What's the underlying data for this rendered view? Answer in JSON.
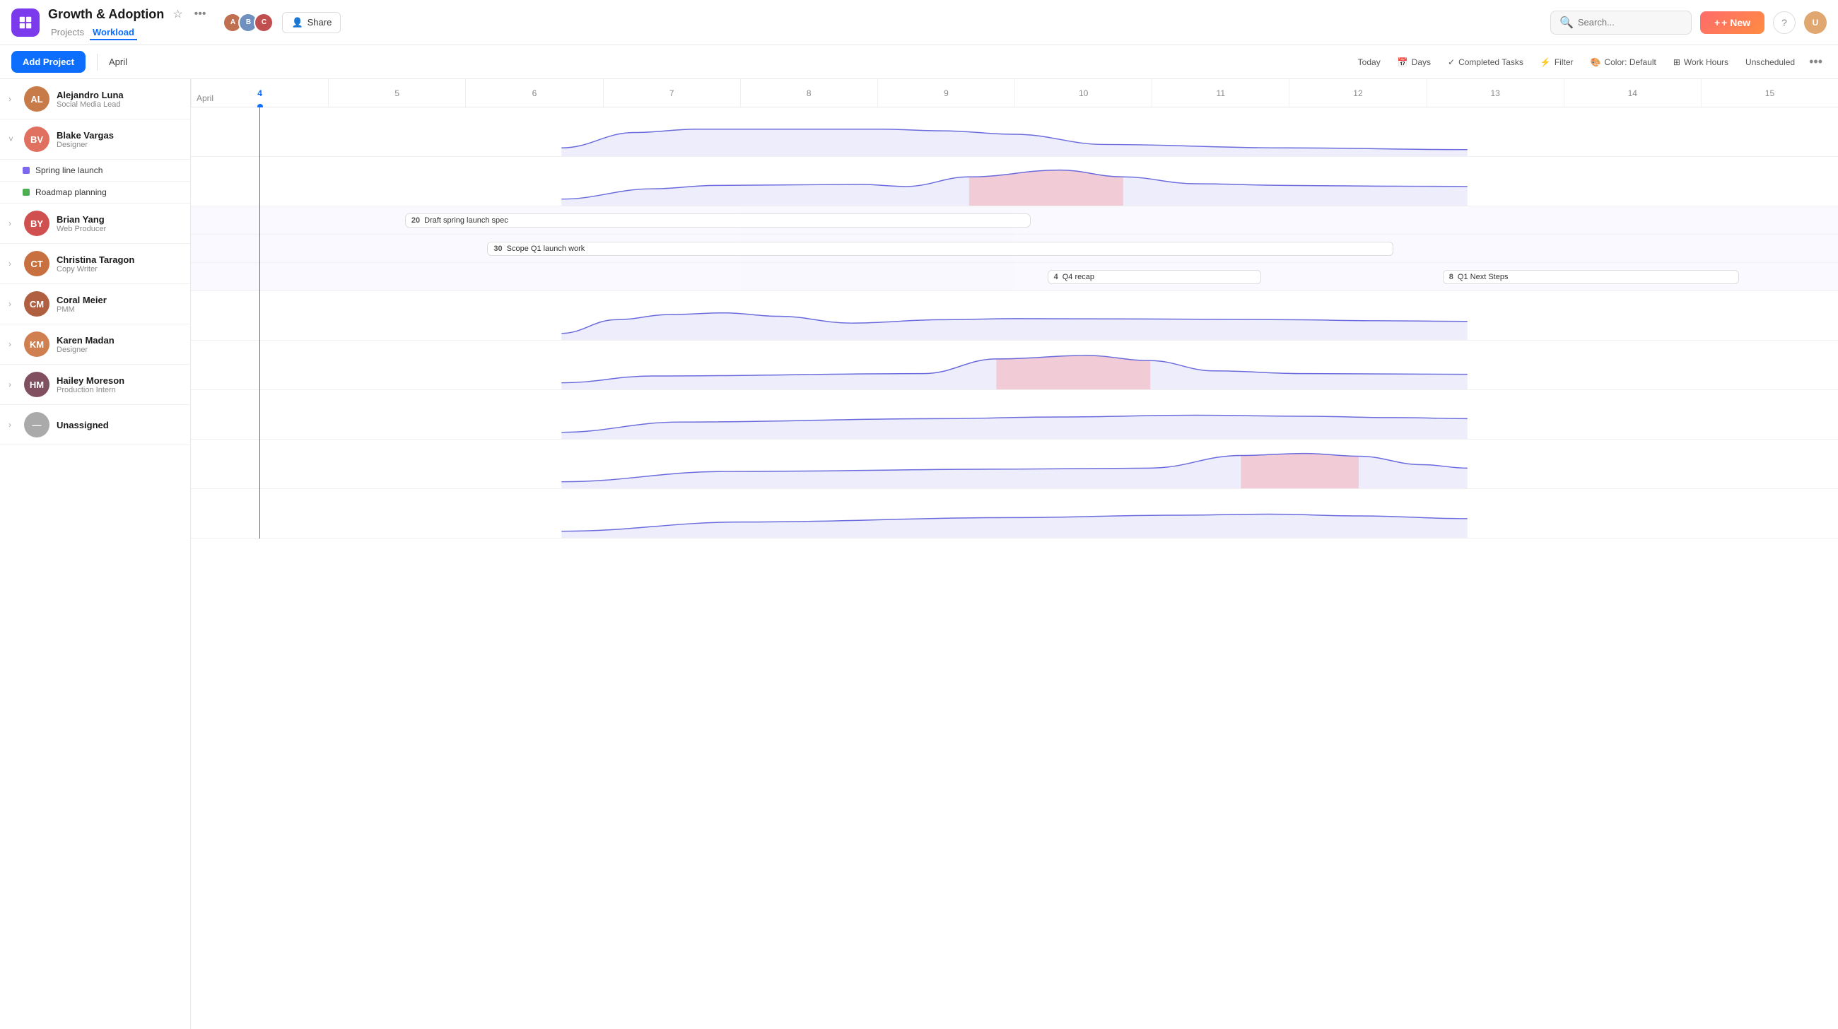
{
  "app": {
    "icon_label": "M",
    "title": "Growth & Adoption",
    "nav_tabs": [
      {
        "id": "projects",
        "label": "Projects",
        "active": false
      },
      {
        "id": "workload",
        "label": "Workload",
        "active": true
      }
    ]
  },
  "header": {
    "search_placeholder": "Search...",
    "new_button": "+ New",
    "share_button": "Share"
  },
  "toolbar": {
    "add_project": "Add Project",
    "month_label": "April",
    "today_btn": "Today",
    "days_btn": "Days",
    "completed_tasks_btn": "Completed Tasks",
    "filter_btn": "Filter",
    "color_btn": "Color: Default",
    "work_hours_btn": "Work Hours",
    "unscheduled_btn": "Unscheduled"
  },
  "dates": [
    4,
    5,
    6,
    7,
    8,
    9,
    10,
    11,
    12,
    13,
    14,
    15
  ],
  "people": [
    {
      "id": "alejandro",
      "name": "Alejandro Luna",
      "role": "Social Media Lead",
      "avatar_color": "#c77b48",
      "has_children": false,
      "expanded": false
    },
    {
      "id": "blake",
      "name": "Blake Vargas",
      "role": "Designer",
      "avatar_color": "#e07060",
      "has_children": true,
      "expanded": true,
      "projects": [
        {
          "name": "Spring line launch",
          "color": "#7b68ee"
        },
        {
          "name": "Roadmap planning",
          "color": "#4caf50"
        }
      ]
    },
    {
      "id": "brian",
      "name": "Brian Yang",
      "role": "Web Producer",
      "avatar_color": "#d05050",
      "has_children": false,
      "expanded": false
    },
    {
      "id": "christina",
      "name": "Christina Taragon",
      "role": "Copy Writer",
      "avatar_color": "#c87040",
      "has_children": false,
      "expanded": false
    },
    {
      "id": "coral",
      "name": "Coral Meier",
      "role": "PMM",
      "avatar_color": "#b06040",
      "has_children": false,
      "expanded": false
    },
    {
      "id": "karen",
      "name": "Karen Madan",
      "role": "Designer",
      "avatar_color": "#d08050",
      "has_children": false,
      "expanded": false
    },
    {
      "id": "hailey",
      "name": "Hailey Moreson",
      "role": "Production Intern",
      "avatar_color": "#805060",
      "has_children": false,
      "expanded": false
    },
    {
      "id": "unassigned",
      "name": "Unassigned",
      "role": "",
      "avatar_color": "#aaa",
      "has_children": false,
      "expanded": false
    }
  ],
  "task_pills": [
    {
      "label": "Draft spring launch spec",
      "num": 20,
      "row": "spring_launch",
      "left_pct": 18,
      "width_pct": 40
    },
    {
      "label": "Scope Q1 launch work",
      "num": 30,
      "row": "spring_launch2",
      "left_pct": 22,
      "width_pct": 56
    },
    {
      "label": "Q4 recap",
      "num": 4,
      "row": "roadmap1",
      "left_pct": 52,
      "width_pct": 14
    },
    {
      "label": "Q1 Next Steps",
      "num": 8,
      "row": "roadmap2",
      "left_pct": 76,
      "width_pct": 18
    }
  ],
  "colors": {
    "accent_blue": "#0d6efd",
    "purple": "#7b68ee",
    "green": "#4caf50",
    "overload_red": "rgba(255,80,80,0.18)",
    "weekend_shade": "rgba(235,235,245,0.5)"
  }
}
